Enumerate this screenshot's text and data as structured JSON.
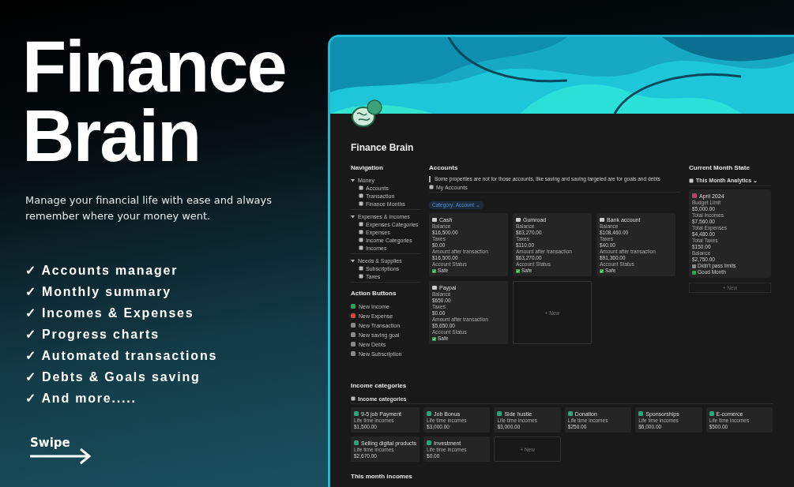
{
  "promo": {
    "headline": [
      "Finance",
      "Brain"
    ],
    "tagline": "Manage your financial life with ease and always remember where your money went.",
    "features": [
      "✓ Accounts manager",
      "✓ Monthly summary",
      "✓ Incomes & Expenses",
      "✓ Progress charts",
      "✓ Automated transactions",
      "✓ Debts & Goals saving",
      "✓ And more....."
    ],
    "swipe": "Swipe"
  },
  "page": {
    "title": "Finance Brain",
    "navigation": {
      "heading": "Navigation",
      "groups": [
        {
          "label": "Money",
          "expanded": true,
          "children": [
            "Accounts",
            "Transaction",
            "Finance Months"
          ]
        },
        {
          "label": "Expenses & Incomes",
          "expanded": true,
          "children": [
            "Expenses Categories",
            "Expenses",
            "Income Categories",
            "Incomes"
          ]
        },
        {
          "label": "Needs & Supplies",
          "expanded": true,
          "children": [
            "Subscriptions",
            "Taxes"
          ]
        }
      ]
    },
    "action_buttons": {
      "heading": "Action Buttons",
      "items": [
        {
          "label": "New Income",
          "color": "#2f9e5b"
        },
        {
          "label": "New Expense",
          "color": "#d0453f"
        },
        {
          "label": "New Transaction",
          "color": "#8a8a8a"
        },
        {
          "label": "New saving goal",
          "color": "#8a8a8a"
        },
        {
          "label": "New Debts",
          "color": "#8a8a8a"
        },
        {
          "label": "New Subscription",
          "color": "#8a8a8a"
        }
      ]
    },
    "accounts": {
      "heading": "Accounts",
      "callout": "Some properties are not for those accounts, like saving and saving targeted are for goals and debts",
      "view": "My Accounts",
      "filter": "Category: Account ⌄",
      "cards": [
        {
          "name": "Cash",
          "fields": [
            {
              "label": "Balance",
              "value": "$16,500.00"
            },
            {
              "label": "Taxes",
              "value": "$0.00"
            },
            {
              "label": "Amount after transaction",
              "value": "$16,500.00"
            }
          ],
          "status_label": "Account Status",
          "status": "Safe"
        },
        {
          "name": "Gumroad",
          "fields": [
            {
              "label": "Balance",
              "value": "$63,270.00"
            },
            {
              "label": "Taxes",
              "value": "$110.00"
            },
            {
              "label": "Amount after transaction",
              "value": "$63,270.00"
            }
          ],
          "status_label": "Account Status",
          "status": "Safe"
        },
        {
          "name": "Bank account",
          "fields": [
            {
              "label": "Balance",
              "value": "$108,460.00"
            },
            {
              "label": "Taxes",
              "value": "$40.00"
            },
            {
              "label": "Amount after transaction",
              "value": "$91,360.00"
            }
          ],
          "status_label": "Account Status",
          "status": "Safe"
        },
        {
          "name": "Paypal",
          "fields": [
            {
              "label": "Balance",
              "value": "$650.00"
            },
            {
              "label": "Taxes",
              "value": "$0.00"
            },
            {
              "label": "Amount after transaction",
              "value": "$5,650.00"
            }
          ],
          "status_label": "Account Status",
          "status": "Safe"
        }
      ],
      "new_label": "+ New"
    },
    "current_month": {
      "heading": "Current Month State",
      "view": "This Month Analytics ⌄",
      "card": {
        "name": "April 2024",
        "fields": [
          {
            "label": "Budget Limit",
            "value": "$5,000.00"
          },
          {
            "label": "Total Incomes",
            "value": "$7,560.00"
          },
          {
            "label": "Total Expenses",
            "value": "$4,480.00"
          },
          {
            "label": "Total Taxes",
            "value": "$150.00"
          },
          {
            "label": "Balance",
            "value": "$2,750.00"
          }
        ],
        "checks": [
          {
            "label": "Didn't pass limits",
            "color": "#8a8a8a"
          },
          {
            "label": "Good Month",
            "color": "#2fa84f"
          }
        ]
      },
      "new_label": "+ New"
    },
    "income_categories": {
      "heading": "Income categories",
      "view": "Income categories",
      "cards": [
        {
          "name": "9-5 job Payment",
          "label": "Life time incomes",
          "value": "$1,500.00"
        },
        {
          "name": "Job Bonus",
          "label": "Life time incomes",
          "value": "$3,000.00"
        },
        {
          "name": "Side hustle",
          "label": "Life time incomes",
          "value": "$3,000.00"
        },
        {
          "name": "Donation",
          "label": "Life time incomes",
          "value": "$250.00"
        },
        {
          "name": "Sponsorships",
          "label": "Life time incomes",
          "value": "$6,000.00"
        },
        {
          "name": "E-comerce",
          "label": "Life time incomes",
          "value": "$500.00"
        },
        {
          "name": "Selling digital products",
          "label": "Life time incomes",
          "value": "$2,670.00"
        },
        {
          "name": "Investment",
          "label": "Life time incomes",
          "value": "$0.00"
        }
      ],
      "new_label": "+ New"
    },
    "next_heading": "This month incomes"
  }
}
